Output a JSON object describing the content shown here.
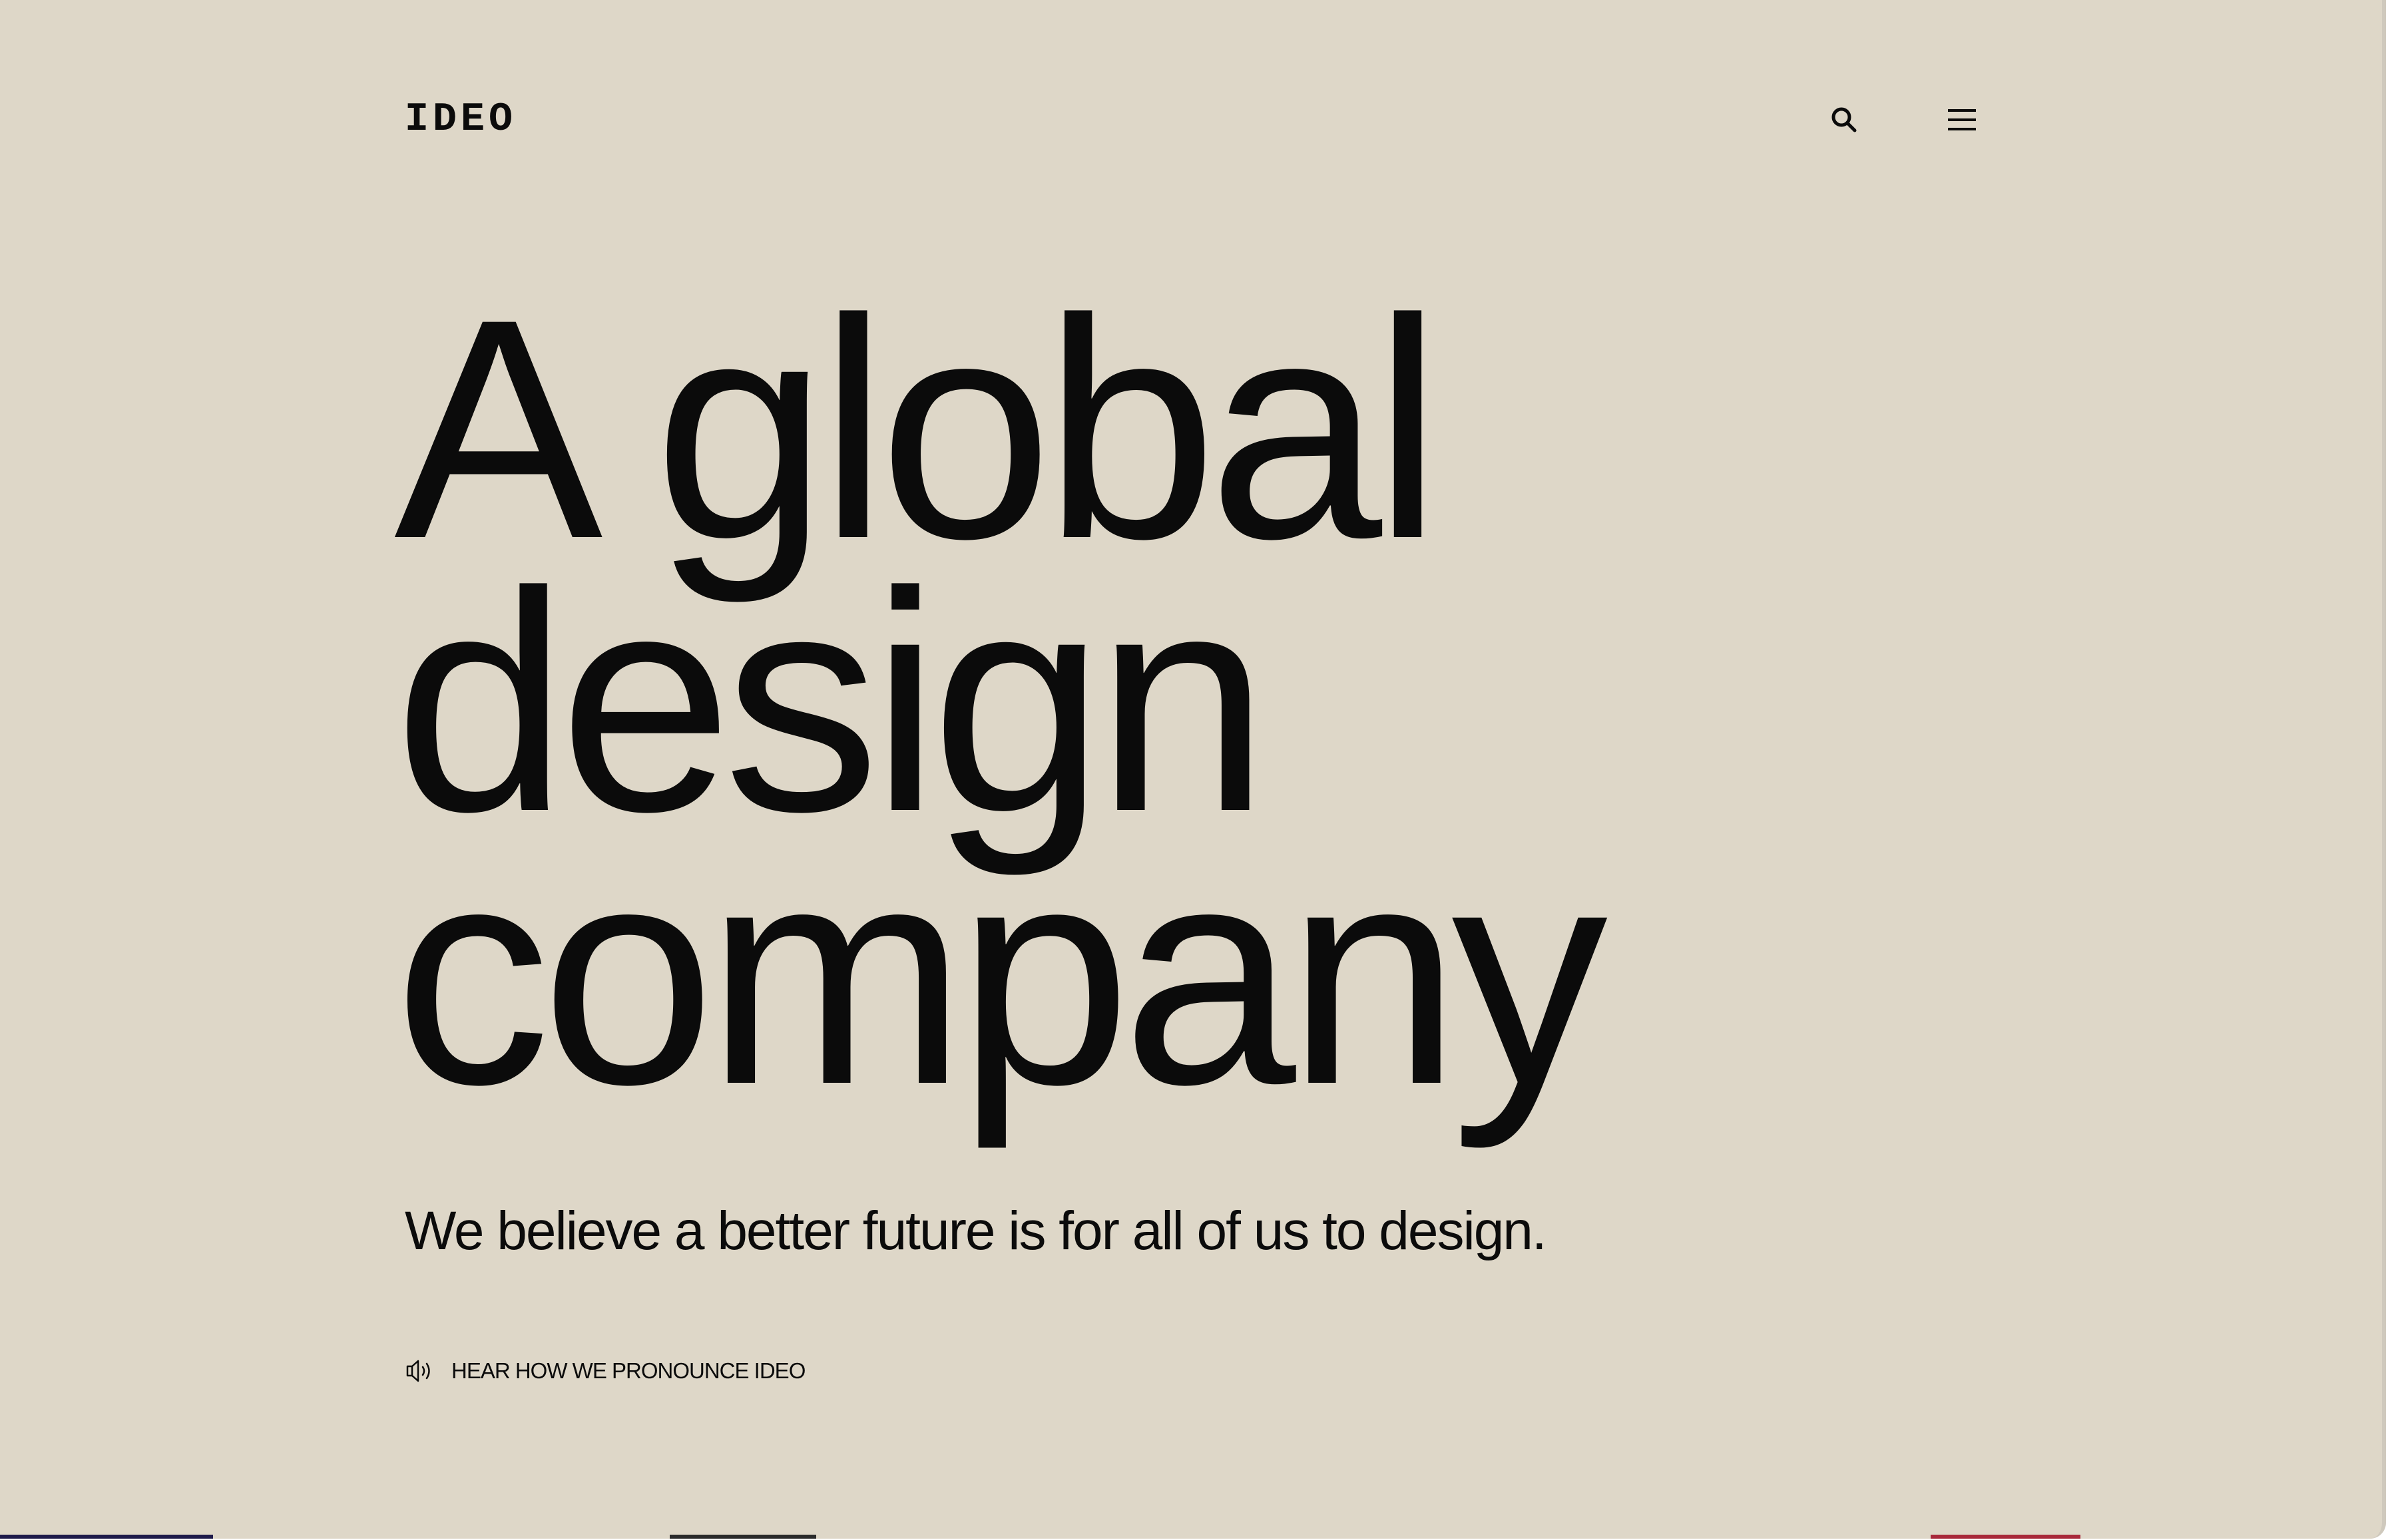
{
  "header": {
    "logo_text": "IDEO",
    "search_icon": "search-icon",
    "menu_icon": "hamburger-menu-icon"
  },
  "hero": {
    "headline_line1": "A global",
    "headline_line2": "design",
    "headline_line3": "company",
    "tagline": "We believe a better future is for all of us to design.",
    "pronounce_icon": "speaker-icon",
    "pronounce_label": "HEAR HOW WE PRONOUNCE IDEO"
  },
  "colors": {
    "background": "#ded7c8",
    "text": "#0b0b0b"
  }
}
